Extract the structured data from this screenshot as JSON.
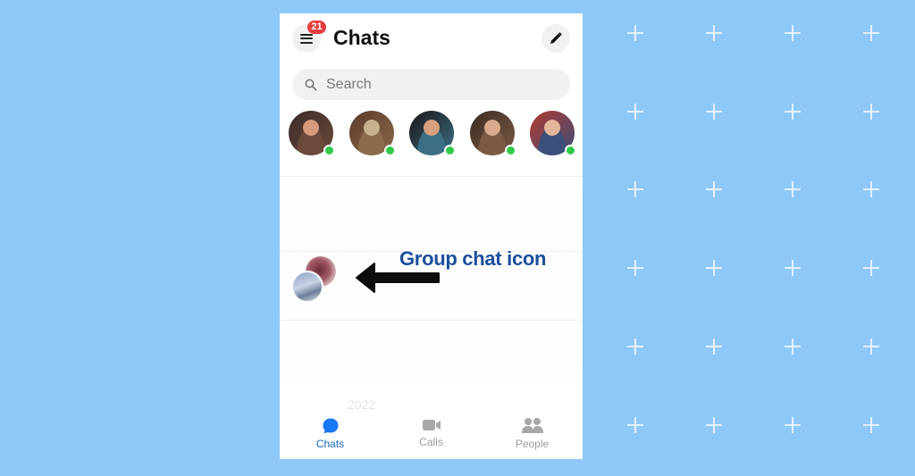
{
  "header": {
    "title": "Chats",
    "notification_count": "21"
  },
  "search": {
    "placeholder": "Search",
    "value": ""
  },
  "stories": [
    {
      "name": "contact-1",
      "online": true,
      "colors": [
        "#3b2a2a",
        "#d59a7b",
        "#6a4a3a"
      ]
    },
    {
      "name": "contact-2",
      "online": true,
      "colors": [
        "#5b3b2b",
        "#c9b08e",
        "#8a6a4a"
      ]
    },
    {
      "name": "contact-3",
      "online": true,
      "colors": [
        "#1c1414",
        "#d9a07e",
        "#3a6f86"
      ]
    },
    {
      "name": "contact-4",
      "online": true,
      "colors": [
        "#3b2b22",
        "#d8a98a",
        "#7a5a44"
      ]
    },
    {
      "name": "contact-5",
      "online": true,
      "colors": [
        "#b23a2f",
        "#e3b89a",
        "#3a4f7a"
      ]
    }
  ],
  "annotation": {
    "label": "Group chat icon"
  },
  "faint_text": "2022",
  "bottom_nav": [
    {
      "label": "Chats",
      "icon": "chat-bubble-icon",
      "active": true
    },
    {
      "label": "Calls",
      "icon": "video-camera-icon",
      "active": false
    },
    {
      "label": "People",
      "icon": "people-icon",
      "active": false
    }
  ],
  "colors": {
    "background": "#8ec8f8",
    "accent": "#1877f2",
    "badge": "#e53e3e",
    "online": "#31c94a",
    "annotation": "#1b4f9c"
  }
}
